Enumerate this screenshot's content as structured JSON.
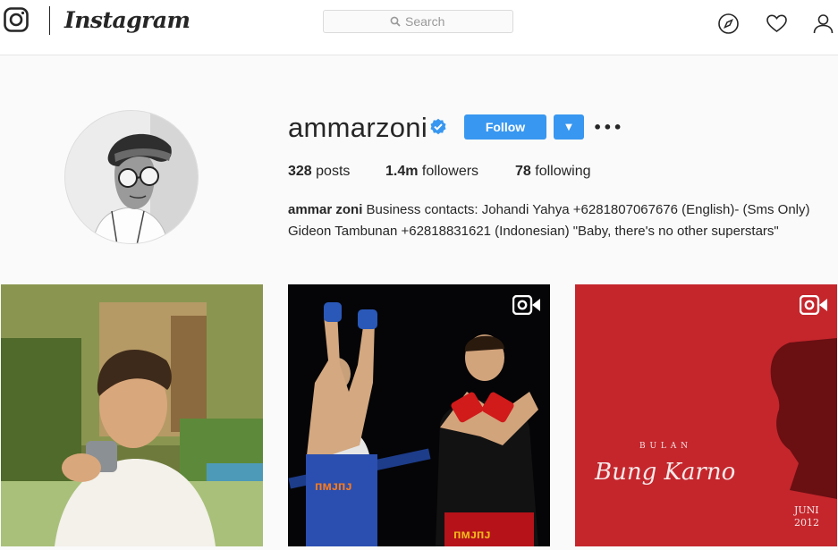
{
  "header": {
    "brand": "Instagram",
    "search_placeholder": "Search"
  },
  "nav_icons": [
    "compass-icon",
    "heart-icon",
    "user-icon"
  ],
  "profile": {
    "username": "ammarzoni",
    "verified": true,
    "follow_label": "Follow",
    "stats": {
      "posts_count": "328",
      "posts_label": "posts",
      "followers_count": "1.4m",
      "followers_label": "followers",
      "following_count": "78",
      "following_label": "following"
    },
    "bio": {
      "full_name": "ammar zoni",
      "line1": "Business contacts: Johandi Yahya +6281807067676 (English)- (Sms Only)",
      "line2": "Gideon Tambunan +62818831621 (Indonesian) \"Baby, there's no other superstars\""
    }
  },
  "posts": [
    {
      "type": "photo"
    },
    {
      "type": "video",
      "shorts_text": "ᴨᴍᴊᴨᴊ",
      "shorts_text_2": "ᴨᴍᴊᴨᴊ"
    },
    {
      "type": "video",
      "small_caption": "B U L A N",
      "script_caption": "Bung Karno",
      "corner_text_1": "JUNI",
      "corner_text_2": "2012"
    }
  ],
  "colors": {
    "accent": "#3897f0",
    "verified": "#3897f0",
    "post3_background": "#c4262c"
  }
}
